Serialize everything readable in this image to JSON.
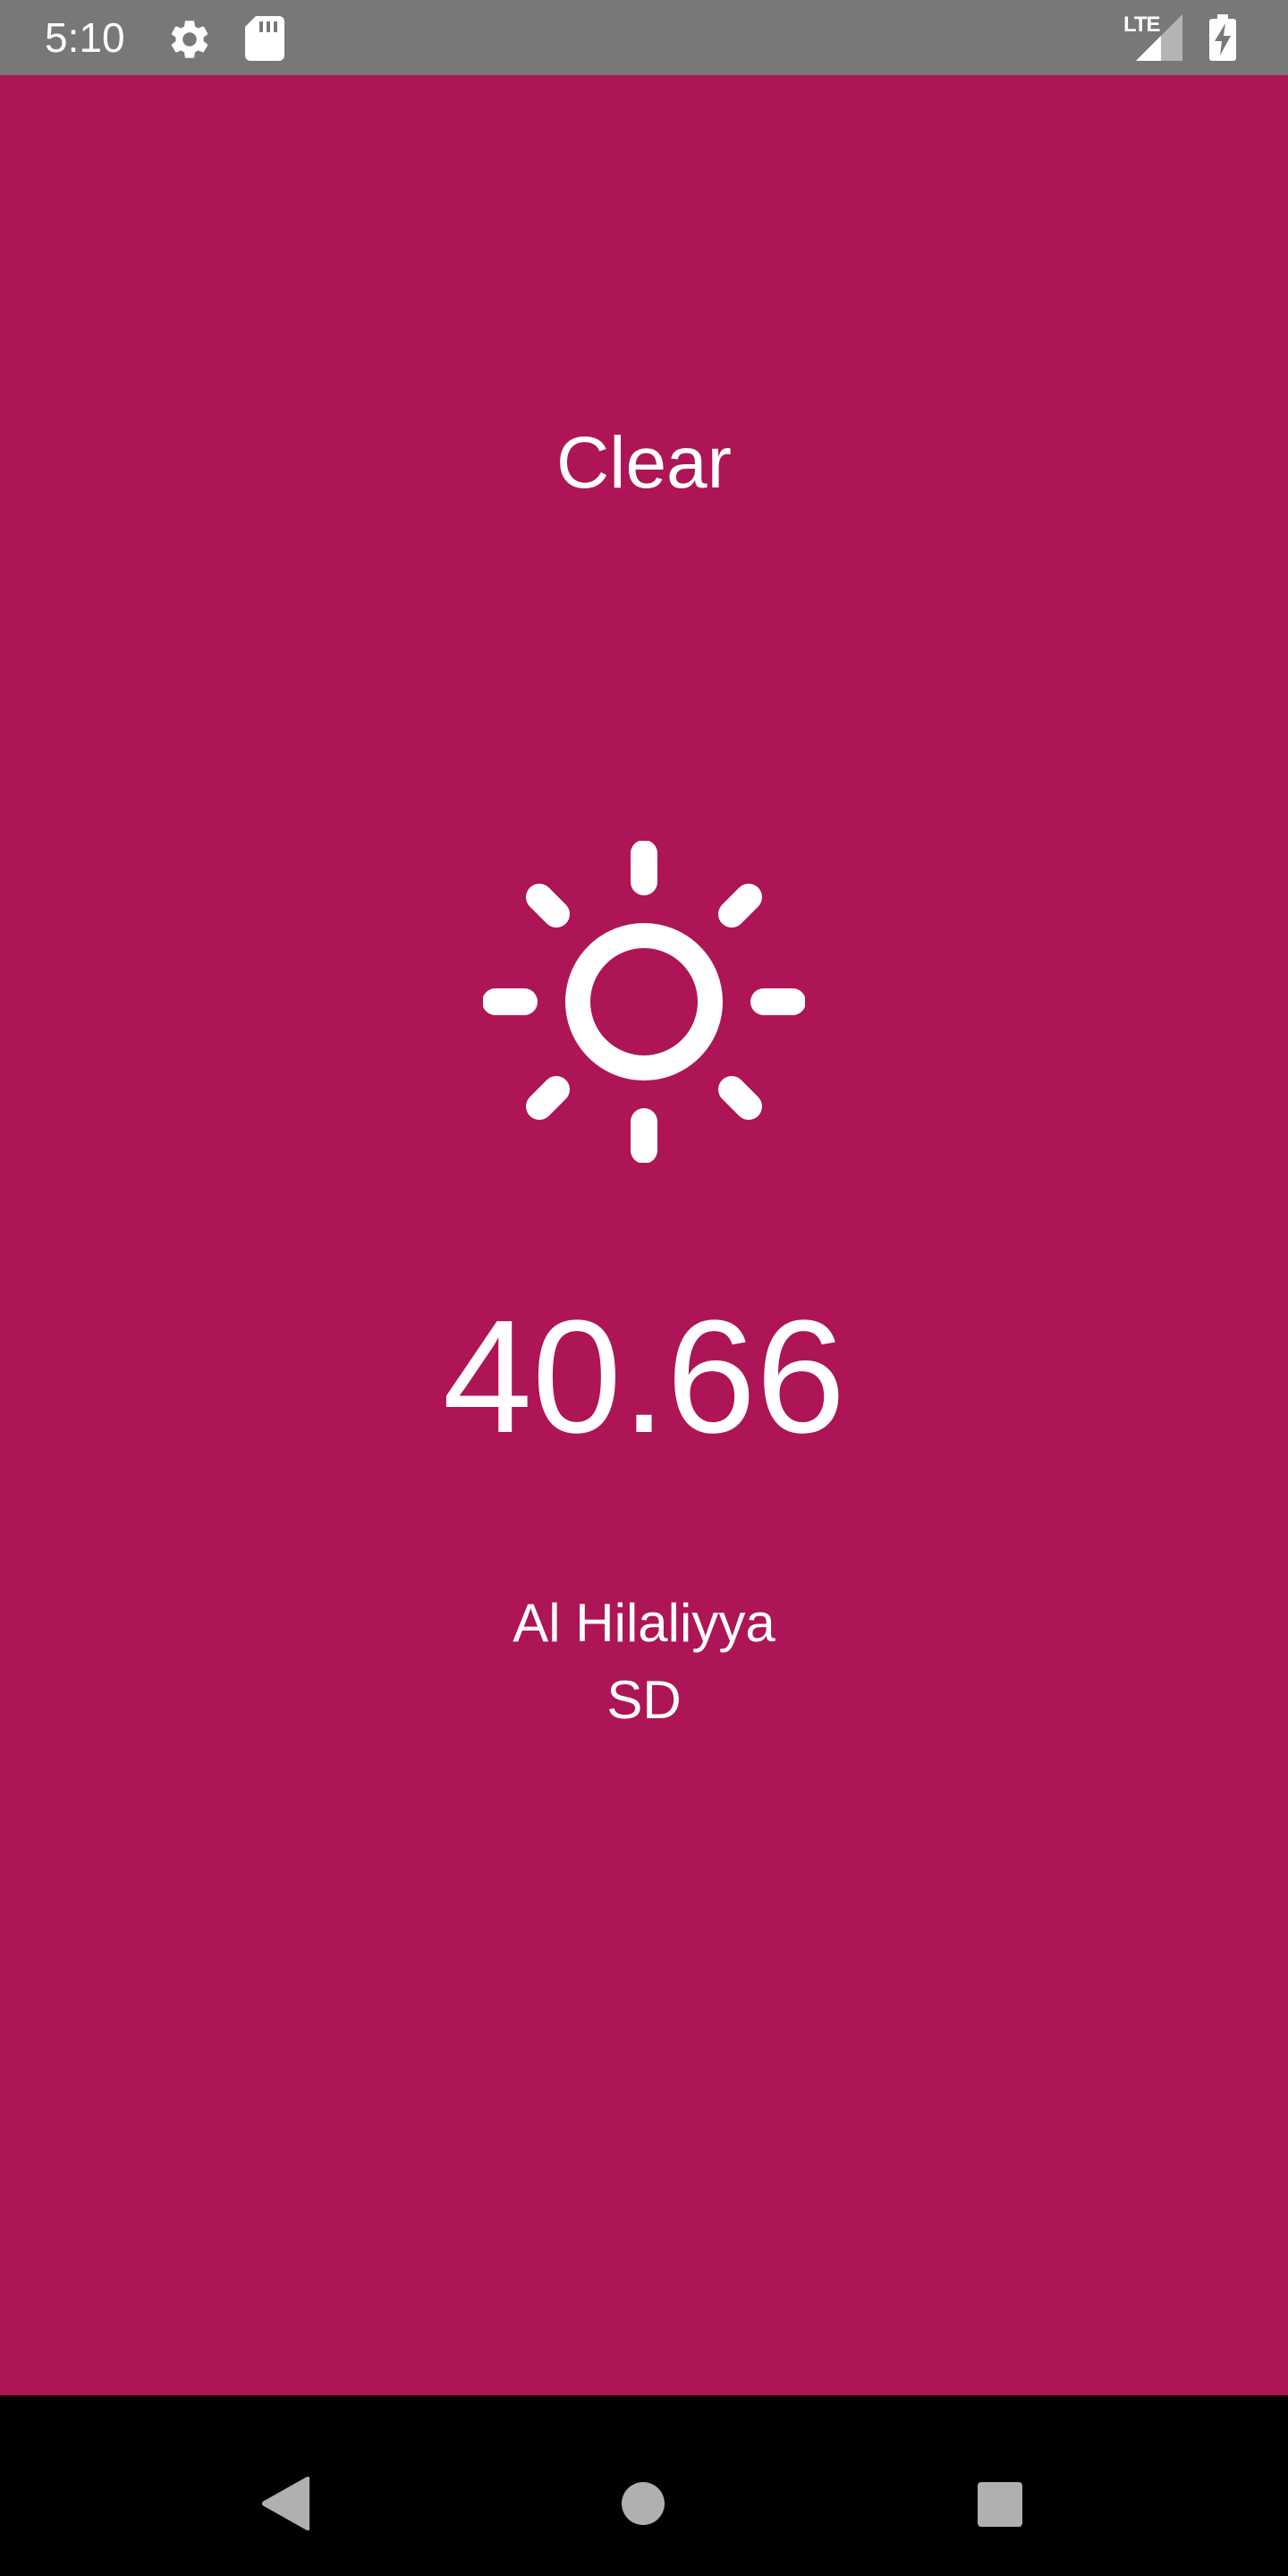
{
  "status_bar": {
    "time": "5:10",
    "network_label": "LTE",
    "icons": [
      "gear-icon",
      "sd-card-icon",
      "signal-icon",
      "battery-charging-icon"
    ]
  },
  "weather": {
    "condition": "Clear",
    "icon": "sun-icon",
    "temperature": "40.66",
    "city": "Al Hilaliyya",
    "country": "SD"
  },
  "navigation": {
    "buttons": [
      "back-icon",
      "home-icon",
      "recents-icon"
    ]
  },
  "colors": {
    "background": "#ad1556",
    "status_bar": "#787878",
    "nav_bar": "#000000",
    "text": "#ffffff"
  }
}
